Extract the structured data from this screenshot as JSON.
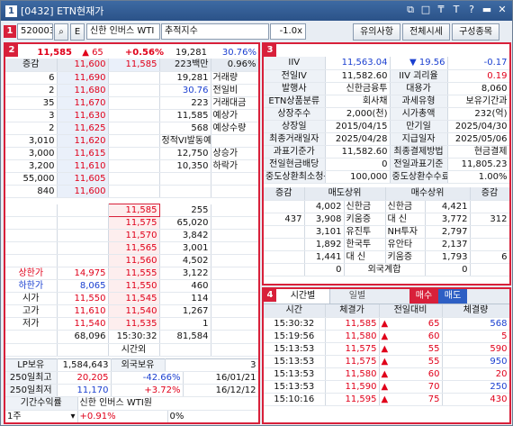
{
  "window": {
    "title": "[0432] ETN현재가",
    "controls": [
      "⧉",
      "□",
      "₸",
      "T",
      "?",
      "▬",
      "✕"
    ]
  },
  "toolbar": {
    "code": "520003",
    "search_icon": "search-icon",
    "etn_label": "E",
    "name": "신한 인버스 WTI",
    "index_label": "추적지수",
    "value": "-1.0x",
    "buttons": [
      "유의사항",
      "전체시세",
      "구성종목"
    ]
  },
  "badges": [
    "1",
    "2",
    "3",
    "4"
  ],
  "quote": {
    "price": "11,585",
    "change": "65",
    "pct": "+0.56%",
    "volume": "19,281",
    "ratio": "30.76%",
    "hoga_label": "증감",
    "open_price": "11,600",
    "cur": "11,585",
    "amount": "223백만",
    "rate": "0.96%"
  },
  "asks": [
    {
      "qty": "6",
      "price": "11,690",
      "info_val": "19,281",
      "info_lbl": "거래량"
    },
    {
      "qty": "2",
      "price": "11,680",
      "info_val": "30.76",
      "info_lbl": "전일비"
    },
    {
      "qty": "35",
      "price": "11,670",
      "info_val": "223",
      "info_lbl": "거래대금"
    },
    {
      "qty": "3",
      "price": "11,630",
      "info_val": "11,585",
      "info_lbl": "예상가"
    },
    {
      "qty": "2",
      "price": "11,625",
      "info_val": "568",
      "info_lbl": "예상수량"
    },
    {
      "qty": "3,010",
      "price": "11,620",
      "info_val": "정적VI발동예상",
      "info_lbl": ""
    },
    {
      "qty": "3,000",
      "price": "11,615",
      "info_val": "12,750",
      "info_lbl": "상승가"
    },
    {
      "qty": "3,200",
      "price": "11,610",
      "info_val": "10,350",
      "info_lbl": "하락가"
    },
    {
      "qty": "55,000",
      "price": "11,605",
      "info_val": "",
      "info_lbl": ""
    },
    {
      "qty": "840",
      "price": "11,600",
      "info_val": "",
      "info_lbl": ""
    }
  ],
  "bids": [
    {
      "lbl": "",
      "val": "",
      "price": "11,585",
      "qty": "255"
    },
    {
      "lbl": "",
      "val": "",
      "price": "11,575",
      "qty": "65,020"
    },
    {
      "lbl": "",
      "val": "",
      "price": "11,570",
      "qty": "3,842"
    },
    {
      "lbl": "",
      "val": "",
      "price": "11,565",
      "qty": "3,001"
    },
    {
      "lbl": "",
      "val": "",
      "price": "11,560",
      "qty": "4,502"
    },
    {
      "lbl": "상한가",
      "val": "14,975",
      "price": "11,555",
      "qty": "3,122"
    },
    {
      "lbl": "하한가",
      "val": "8,065",
      "price": "11,550",
      "qty": "460"
    },
    {
      "lbl": "시가",
      "val": "11,550",
      "price": "11,545",
      "qty": "114"
    },
    {
      "lbl": "고가",
      "val": "11,610",
      "price": "11,540",
      "qty": "1,267"
    },
    {
      "lbl": "저가",
      "val": "11,540",
      "price": "11,535",
      "qty": "1"
    }
  ],
  "totals": {
    "ask_total": "68,096",
    "time": "15:30:32",
    "bid_total": "81,584",
    "time_label": "시간외"
  },
  "lp": {
    "label1": "LP보유",
    "val1": "1,584,643",
    "label2": "외국보유",
    "val2": "3"
  },
  "hist": [
    {
      "label": "250일최고",
      "price": "20,205",
      "pct": "-42.66%",
      "date": "16/01/21"
    },
    {
      "label": "250일최저",
      "price": "11,170",
      "pct": "+3.72%",
      "date": "16/12/12"
    }
  ],
  "ret": {
    "label": "기간수익률",
    "name": "신한 인버스 WTI원",
    "period": "1주",
    "etn": "+0.91%",
    "idx": "0%"
  },
  "info": {
    "iiv_label": "IIV",
    "iiv": "11,563.04",
    "iiv_chg": "19.56",
    "iiv_pct": "-0.17",
    "rows": [
      [
        "전일IV",
        "11,582.60",
        "IIV 괴리율",
        "0.19"
      ],
      [
        "발행사",
        "신한금융투",
        "대용가",
        "8,060"
      ],
      [
        "ETN상품분류",
        "회사채",
        "과세유형",
        "보유기간과"
      ],
      [
        "상장주수",
        "2,000(천)",
        "시가총액",
        "232(억)"
      ],
      [
        "상장일",
        "2015/04/15",
        "만기일",
        "2025/04/30"
      ],
      [
        "최종거래일자",
        "2025/04/28",
        "지급일자",
        "2025/05/06"
      ],
      [
        "과표기준가",
        "11,582.60",
        "최종결제방법",
        "현금결제"
      ],
      [
        "전일현금배당",
        "0",
        "전일과표기준",
        "11,805.23"
      ],
      [
        "중도상환최소청구수량",
        "100,000",
        "중도상환수수료율",
        "1.00%"
      ]
    ]
  },
  "brokers": {
    "headers": [
      "증감",
      "매도상위",
      "매수상위",
      "증감"
    ],
    "sell_change": "437",
    "buy_change": "312",
    "rows": [
      [
        "4,002",
        "신한금",
        "신한금",
        "4,421"
      ],
      [
        "3,908",
        "키움증",
        "대 신",
        "3,772"
      ],
      [
        "3,101",
        "유진투",
        "NH투자",
        "2,797"
      ],
      [
        "1,892",
        "한국투",
        "유안타",
        "2,137"
      ],
      [
        "1,441",
        "대 신",
        "키움증",
        "1,793"
      ]
    ],
    "foreign_label": "외국계합",
    "sell_foreign": "0",
    "buy_foreign": "0",
    "buy_foreign_chg": "6",
    "total_buy": "0"
  },
  "trades": {
    "tabs": [
      "시간별",
      "일별"
    ],
    "sell_label": "매수",
    "buy_label": "매도",
    "headers": [
      "시간",
      "체결가",
      "전일대비",
      "체결량"
    ],
    "rows": [
      [
        "15:30:32",
        "11,585",
        "65",
        "568",
        "blue"
      ],
      [
        "15:19:56",
        "11,580",
        "60",
        "5",
        "red"
      ],
      [
        "15:13:53",
        "11,575",
        "55",
        "590",
        "red"
      ],
      [
        "15:13:53",
        "11,575",
        "55",
        "950",
        "blue"
      ],
      [
        "15:13:53",
        "11,580",
        "60",
        "20",
        "red"
      ],
      [
        "15:13:53",
        "11,590",
        "70",
        "250",
        "blue"
      ],
      [
        "15:10:16",
        "11,595",
        "75",
        "430",
        "red"
      ]
    ]
  }
}
